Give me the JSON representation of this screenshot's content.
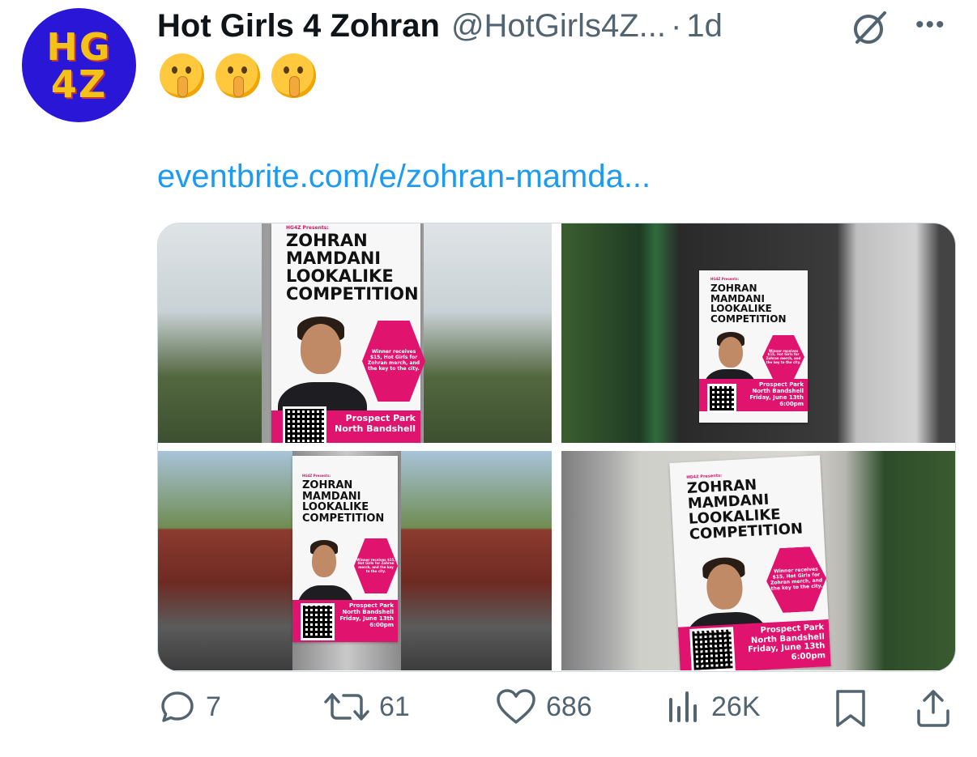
{
  "author": {
    "avatar_text_line1": "HG",
    "avatar_text_line2": "4Z",
    "display_name": "Hot Girls 4 Zohran",
    "handle": "@HotGirls4Z...",
    "separator": "·",
    "time": "1d"
  },
  "icons": {
    "grok": "grok-icon",
    "more": "more-icon",
    "reply": "reply-icon",
    "retweet": "retweet-icon",
    "like": "like-icon",
    "views": "views-icon",
    "bookmark": "bookmark-icon",
    "share": "share-icon"
  },
  "tweet": {
    "emoji_count_label": "shushing-face",
    "link_text": "eventbrite.com/e/zohran-mamda..."
  },
  "poster": {
    "presents": "HG4Z Presents:",
    "title_line1": "ZOHRAN",
    "title_line2": "MAMDANI",
    "title_line3": "LOOKALIKE",
    "title_line4": "COMPETITION",
    "prize": "Winner receives $15, Hot Girls for Zohran merch, and the key to the city.",
    "location_line1": "Prospect Park",
    "location_line2": "North Bandshell",
    "date": "Friday, June 13th",
    "time": "6:00pm"
  },
  "metrics": {
    "replies": "7",
    "retweets": "61",
    "likes": "686",
    "views": "26K"
  },
  "colors": {
    "accent": "#1d9bf0",
    "muted": "#536471",
    "avatar_bg": "#2a16d6",
    "avatar_text": "#f2c21a",
    "poster_pink": "#e0136f"
  }
}
